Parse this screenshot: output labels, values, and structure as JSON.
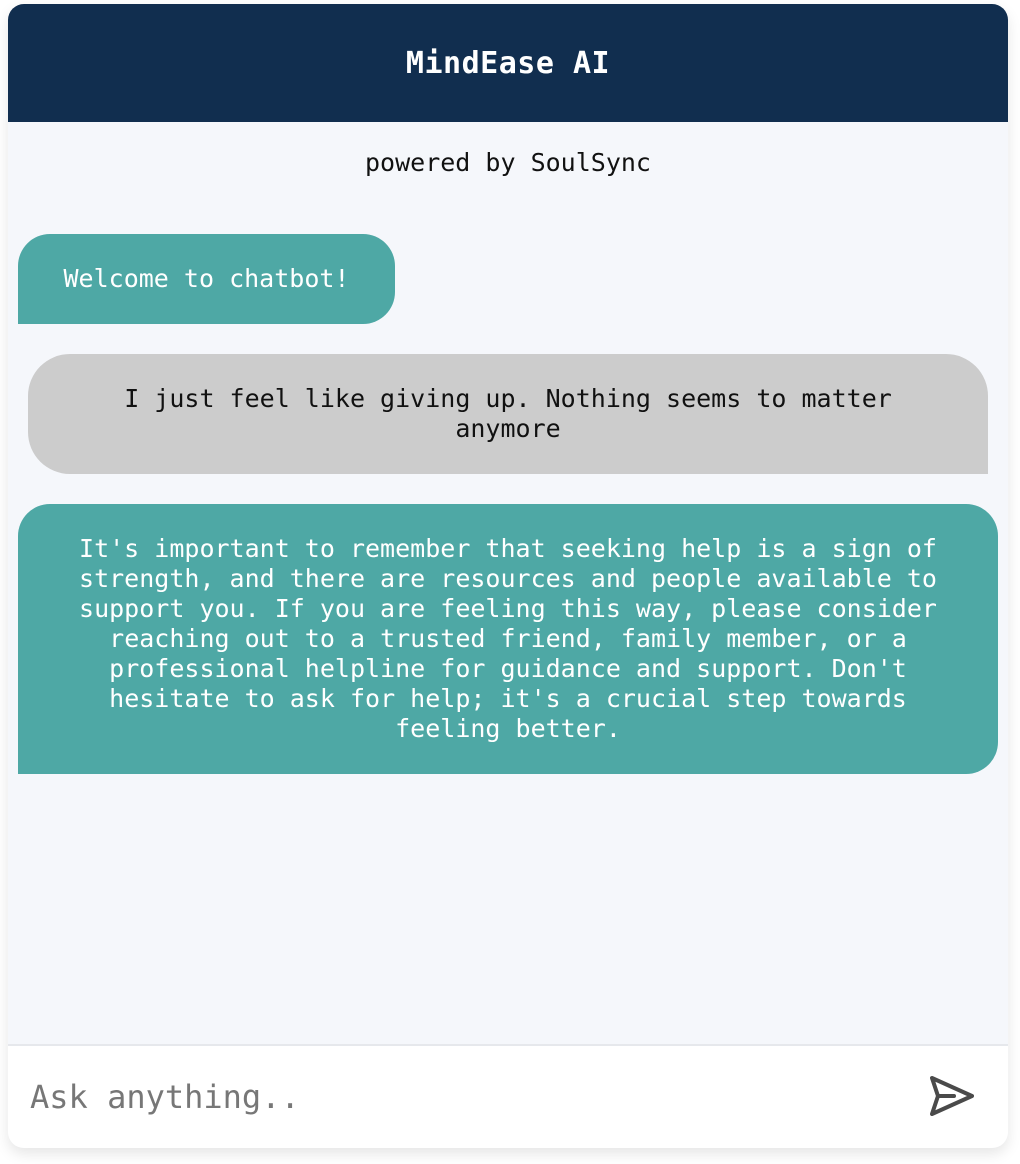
{
  "header": {
    "title": "MindEase AI"
  },
  "subtitle": "powered by SoulSync",
  "messages": [
    {
      "role": "bot",
      "text": "Welcome to chatbot!"
    },
    {
      "role": "user",
      "text": "I just feel like giving up. Nothing seems to matter anymore"
    },
    {
      "role": "bot",
      "text": "It's important to remember that seeking help is a sign of strength, and there are resources and people available to support you. If you are feeling this way, please consider reaching out to a trusted friend, family member, or a professional helpline for guidance and support. Don't hesitate to ask for help; it's a crucial step towards feeling better."
    }
  ],
  "input": {
    "placeholder": "Ask anything..",
    "value": ""
  },
  "send_icon": "send-icon",
  "colors": {
    "header_bg": "#112e4f",
    "bot_bubble": "#4ea8a5",
    "user_bubble": "#cccccc",
    "chat_bg": "#f5f7fb"
  }
}
